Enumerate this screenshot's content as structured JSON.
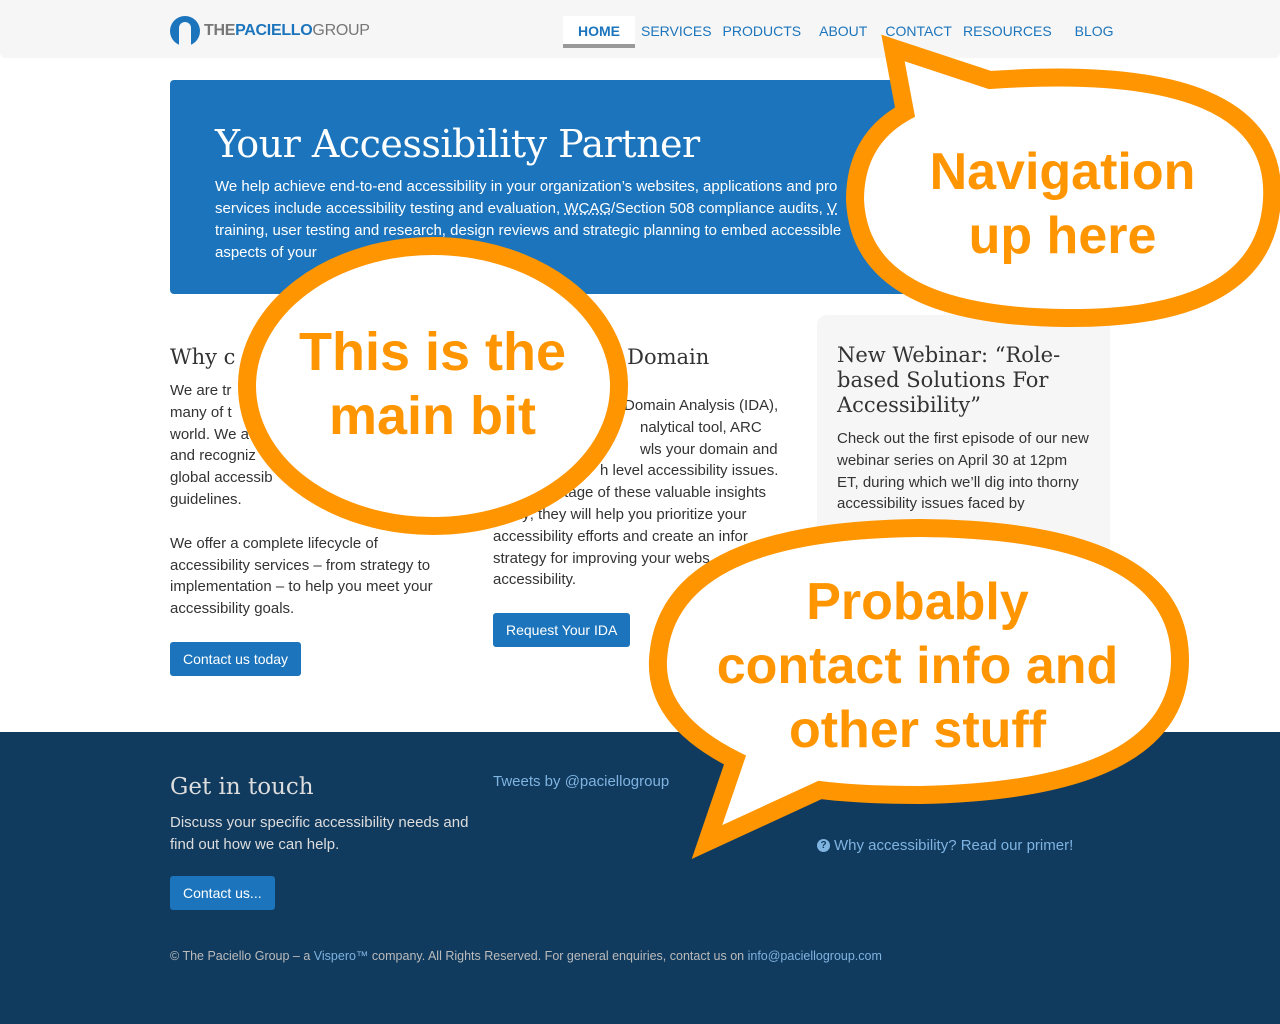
{
  "header": {
    "logo": {
      "the": "THE",
      "paciello": "PACIELLO",
      "group": "GROUP"
    },
    "nav": [
      {
        "label": "HOME",
        "active": true
      },
      {
        "label": "SERVICES"
      },
      {
        "label": "PRODUCTS"
      },
      {
        "label": "ABOUT"
      },
      {
        "label": "CONTACT"
      },
      {
        "label": "RESOURCES"
      },
      {
        "label": "BLOG"
      }
    ]
  },
  "hero": {
    "title": "Your Accessibility Partner",
    "line1": "We help achieve end-to-end accessibility in your organization’s websites, applications and pro",
    "line2_a": "services include accessibility testing and evaluation, ",
    "line2_link": "WCAG",
    "line2_b": "/Section 508 compliance audits, ",
    "line2_link2": "V",
    "line3": "training, user testing and research, design reviews and strategic planning to embed accessible",
    "line4": "aspects of your"
  },
  "col1": {
    "heading": "Why c",
    "para1": "We are trusted by many of the largest organizations in the world. We are and recognized global accessibility guidelines.",
    "para1_lines": [
      "We are tr",
      "many of t",
      "world. We a",
      "and recogniz",
      "global accessib",
      "guidelines."
    ],
    "para2": "We offer a complete lifecycle of accessibility services – from strategy to implementation – to help you meet your accessibility goals.",
    "button": "Contact us today"
  },
  "col2": {
    "heading": "e Domain",
    "para_lines": [
      "Domain Analysis (IDA),",
      "nalytical tool, ARC",
      "wls your domain and",
      "h level accessibility issues.",
      "vantage of these valuable insights",
      "today; they will help you prioritize your",
      "accessibility efforts and create an infor",
      "strategy for improving your webs",
      "accessibility."
    ],
    "button": "Request Your IDA"
  },
  "card": {
    "title": "New Webinar: “Role-based Solutions For Accessibility”",
    "body": "Check out the first episode of our new webinar series on April 30 at 12pm ET, during which we’ll dig into thorny accessibility issues faced by"
  },
  "footer": {
    "heading": "Get in touch",
    "desc": "Discuss your specific accessibility needs and find out how we can help.",
    "button": "Contact us...",
    "tweets": "Tweets by @paciellogroup",
    "primer_icon": "question-circle-icon",
    "primer": "Why accessibility? Read our primer!",
    "copy_a": "© The Paciello Group – a ",
    "copy_link": "Vispero™",
    "copy_b": " company. All Rights Reserved. For general enquiries, contact us on ",
    "copy_email": "info@paciellogroup.com"
  },
  "annotations": {
    "nav": [
      "Navigation",
      "up here"
    ],
    "main": [
      "This is the",
      "main bit"
    ],
    "contact": [
      "Probably",
      "contact info and",
      "other stuff"
    ],
    "color": "#ff9500"
  }
}
